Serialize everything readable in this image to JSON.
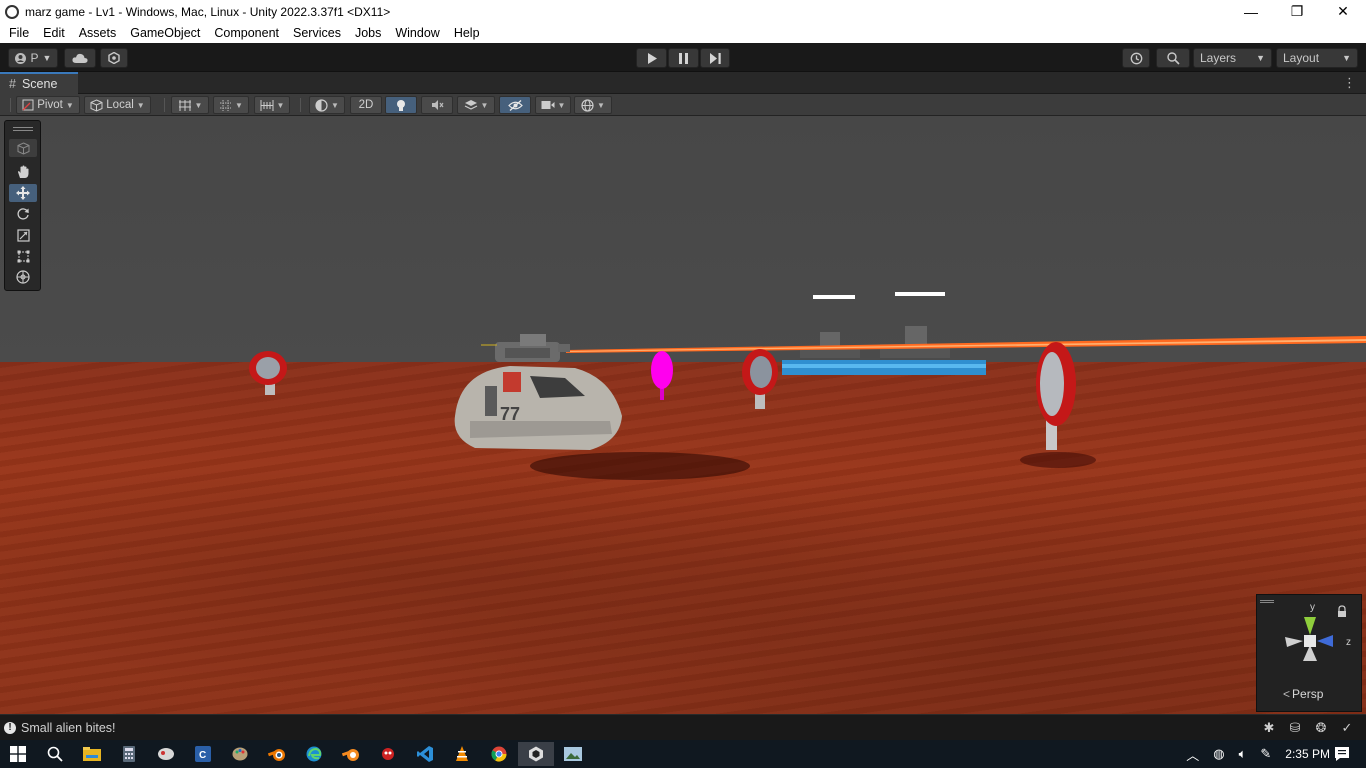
{
  "window": {
    "title": "marz game - Lv1 - Windows, Mac, Linux - Unity 2022.3.37f1 <DX11>",
    "minimize": "—",
    "maximize": "❐",
    "close": "✕"
  },
  "menu": [
    "File",
    "Edit",
    "Assets",
    "GameObject",
    "Component",
    "Services",
    "Jobs",
    "Window",
    "Help"
  ],
  "toolbar": {
    "account_label": "P",
    "play_icon": "play-icon",
    "pause_icon": "pause-icon",
    "step_icon": "step-icon",
    "layers_label": "Layers",
    "layout_label": "Layout"
  },
  "scene_tab": {
    "label": "Scene",
    "hash": "#"
  },
  "scene_toolbar": {
    "pivot_label": "Pivot",
    "local_label": "Local",
    "mode_2d_label": "2D"
  },
  "gizmo": {
    "y_label": "y",
    "z_label": "z",
    "persp_label": "Persp"
  },
  "status": {
    "message": "Small alien bites!"
  },
  "taskbar": {
    "time": "2:35 PM"
  },
  "colors": {
    "accent_tab": "#3a79bb",
    "active_tool": "#46607c",
    "ground": "#993519",
    "sky": "#4b4b4b",
    "laser": "#ff5a10",
    "target_ring": "#c41818",
    "magenta_balloon": "#ff00ee"
  }
}
